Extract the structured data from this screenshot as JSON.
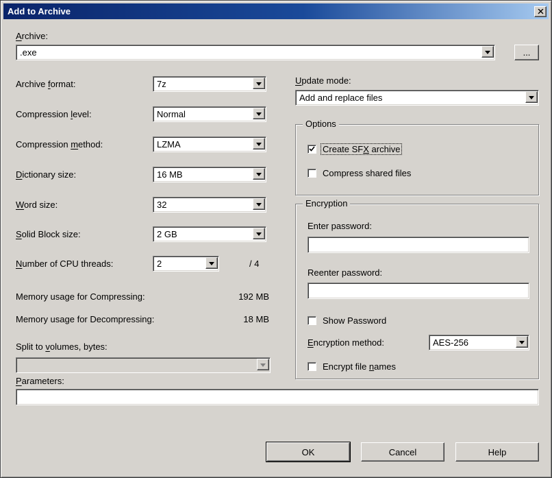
{
  "window": {
    "title": "Add to Archive"
  },
  "archive": {
    "label": "&Archive:",
    "value": ".exe",
    "browse_label": "..."
  },
  "left": {
    "rows": [
      {
        "label": "Archive &format:",
        "value": "7z"
      },
      {
        "label": "Compression &level:",
        "value": "Normal"
      },
      {
        "label": "Compression &method:",
        "value": "LZMA"
      },
      {
        "label": "&Dictionary size:",
        "value": "16 MB"
      },
      {
        "label": "&Word size:",
        "value": "32"
      },
      {
        "label": "&Solid Block size:",
        "value": "2 GB"
      },
      {
        "label": "&Number of CPU threads:",
        "value": "2"
      }
    ],
    "cpu_suffix": "/ 4",
    "memory_compress": {
      "label": "Memory usage for Compressing:",
      "value": "192 MB"
    },
    "memory_decompress": {
      "label": "Memory usage for Decompressing:",
      "value": "18 MB"
    },
    "split": {
      "label": "Split to &volumes, bytes:",
      "value": ""
    }
  },
  "right": {
    "update_mode": {
      "label": "&Update mode:",
      "value": "Add and replace files"
    },
    "options": {
      "title": "Options",
      "sfx": {
        "label": "Create SF&X archive",
        "checked": true
      },
      "shared": {
        "label": "Compress shared files",
        "checked": false
      }
    },
    "encryption": {
      "title": "Encryption",
      "enter_password_label": "Enter password:",
      "enter_password_value": "",
      "reenter_password_label": "Reenter password:",
      "reenter_password_value": "",
      "show_password": {
        "label": "Show Password",
        "checked": false
      },
      "method": {
        "label": "&Encryption method:",
        "value": "AES-256"
      },
      "encrypt_names": {
        "label": "Encrypt file &names",
        "checked": false
      }
    }
  },
  "parameters": {
    "label": "&Parameters:",
    "value": ""
  },
  "buttons": {
    "ok": "OK",
    "cancel": "Cancel",
    "help": "Help"
  },
  "colors": {
    "titlebar_gradient_start": "#0a246a",
    "titlebar_gradient_end": "#a6caf0",
    "face": "#d6d3ce",
    "field": "#ffffff",
    "text": "#000000",
    "disabled_text": "#808080"
  }
}
